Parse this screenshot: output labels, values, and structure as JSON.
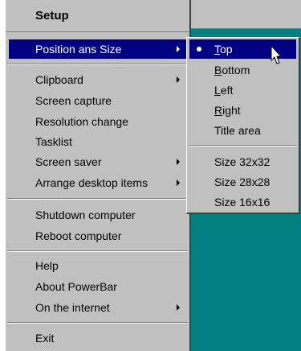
{
  "menu": {
    "header": "Setup",
    "items": [
      {
        "label": "Position ans Size",
        "submenu": true
      },
      {
        "label": "Clipboard",
        "submenu": true
      },
      {
        "label": "Screen capture",
        "submenu": false
      },
      {
        "label": "Resolution change",
        "submenu": false
      },
      {
        "label": "Tasklist",
        "submenu": false
      },
      {
        "label": "Screen saver",
        "submenu": true
      },
      {
        "label": "Arrange desktop items",
        "submenu": true
      },
      {
        "label": "Shutdown computer",
        "submenu": false
      },
      {
        "label": "Reboot computer",
        "submenu": false
      },
      {
        "label": "Help",
        "submenu": false
      },
      {
        "label": "About PowerBar",
        "submenu": false
      },
      {
        "label": "On the internet",
        "submenu": true
      },
      {
        "label": "Exit",
        "submenu": false
      }
    ]
  },
  "submenu": {
    "items": [
      {
        "first": "T",
        "rest": "op",
        "checked": true
      },
      {
        "first": "B",
        "rest": "ottom"
      },
      {
        "first": "L",
        "rest": "eft"
      },
      {
        "first": "R",
        "rest": "ight"
      },
      {
        "first": "",
        "rest": "Title area"
      },
      {
        "first": "",
        "rest": "Size 32x32"
      },
      {
        "first": "",
        "rest": "Size 28x28"
      },
      {
        "first": "",
        "rest": "Size 16x16"
      }
    ]
  },
  "colors": {
    "menu_bg": "#c0c0c0",
    "highlight": "#000080",
    "desktop": "#008080"
  }
}
